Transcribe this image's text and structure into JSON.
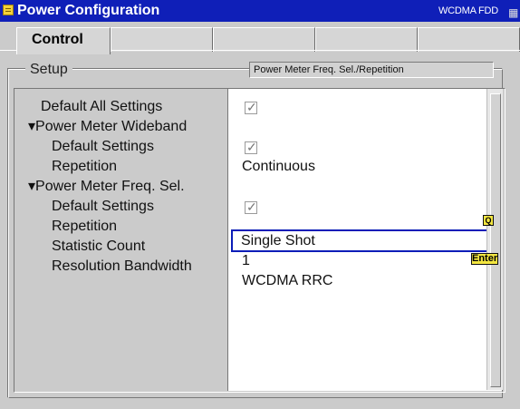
{
  "window": {
    "title": "Power Configuration",
    "mode": "WCDMA FDD",
    "icon": "menu-icon"
  },
  "tabs": [
    {
      "label": "Control",
      "active": true
    },
    {
      "label": "",
      "active": false
    },
    {
      "label": "",
      "active": false
    },
    {
      "label": "",
      "active": false
    },
    {
      "label": "",
      "active": false
    }
  ],
  "setup": {
    "label": "Setup",
    "field": "Power Meter Freq. Sel./Repetition"
  },
  "rows": [
    {
      "label": "Default All Settings",
      "value": "",
      "type": "checkbox",
      "checked": true
    },
    {
      "label": "▾Power Meter Wideband",
      "value": "",
      "type": "section"
    },
    {
      "label": "Default Settings",
      "value": "",
      "type": "checkbox",
      "checked": true
    },
    {
      "label": "Repetition",
      "value": "Continuous",
      "type": "text"
    },
    {
      "label": "▾Power Meter Freq. Sel.",
      "value": "",
      "type": "section"
    },
    {
      "label": "Default Settings",
      "value": "",
      "type": "checkbox",
      "checked": true
    },
    {
      "label": "Repetition",
      "value": "Single Shot",
      "type": "selected"
    },
    {
      "label": "Statistic Count",
      "value": "1",
      "type": "text"
    },
    {
      "label": "Resolution Bandwidth",
      "value": "WCDMA RRC",
      "type": "text"
    }
  ],
  "markers": {
    "q": "Q",
    "enter": "Enter"
  },
  "colors": {
    "titlebar": "#0f1fb8",
    "panel": "#cbcbcb",
    "selection": "#0b1db8",
    "marker": "#f3e640"
  }
}
